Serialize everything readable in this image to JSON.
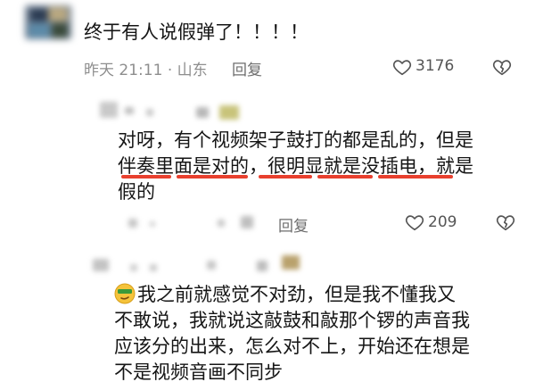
{
  "comments": [
    {
      "text": "终于有人说假弹了！！！！",
      "time": "昨天 21:11",
      "location": "山东",
      "reply_label": "回复",
      "likes": "3176"
    },
    {
      "line1": "对呀，有个视频架子鼓打的都是乱的，但是",
      "line2": "伴奏里面是对的，很明显就是没插电，就是",
      "line3": "假的",
      "reply_label": "回复",
      "likes": "209"
    },
    {
      "emoji": "smirk-emoji",
      "line1": "我之前就感觉不对劲，但是我不懂我又",
      "line2": "不敢说，我就说这敲鼓和敲那个锣的声音我",
      "line3": "应该分的出来，怎么对不上，开始还在想是",
      "line4": "不是视频音画不同步"
    }
  ],
  "colors": {
    "underline": "#e8402e",
    "meta": "#8e8e8e"
  },
  "icons": {
    "like": "heart-outline-icon",
    "dislike": "broken-heart-icon"
  }
}
